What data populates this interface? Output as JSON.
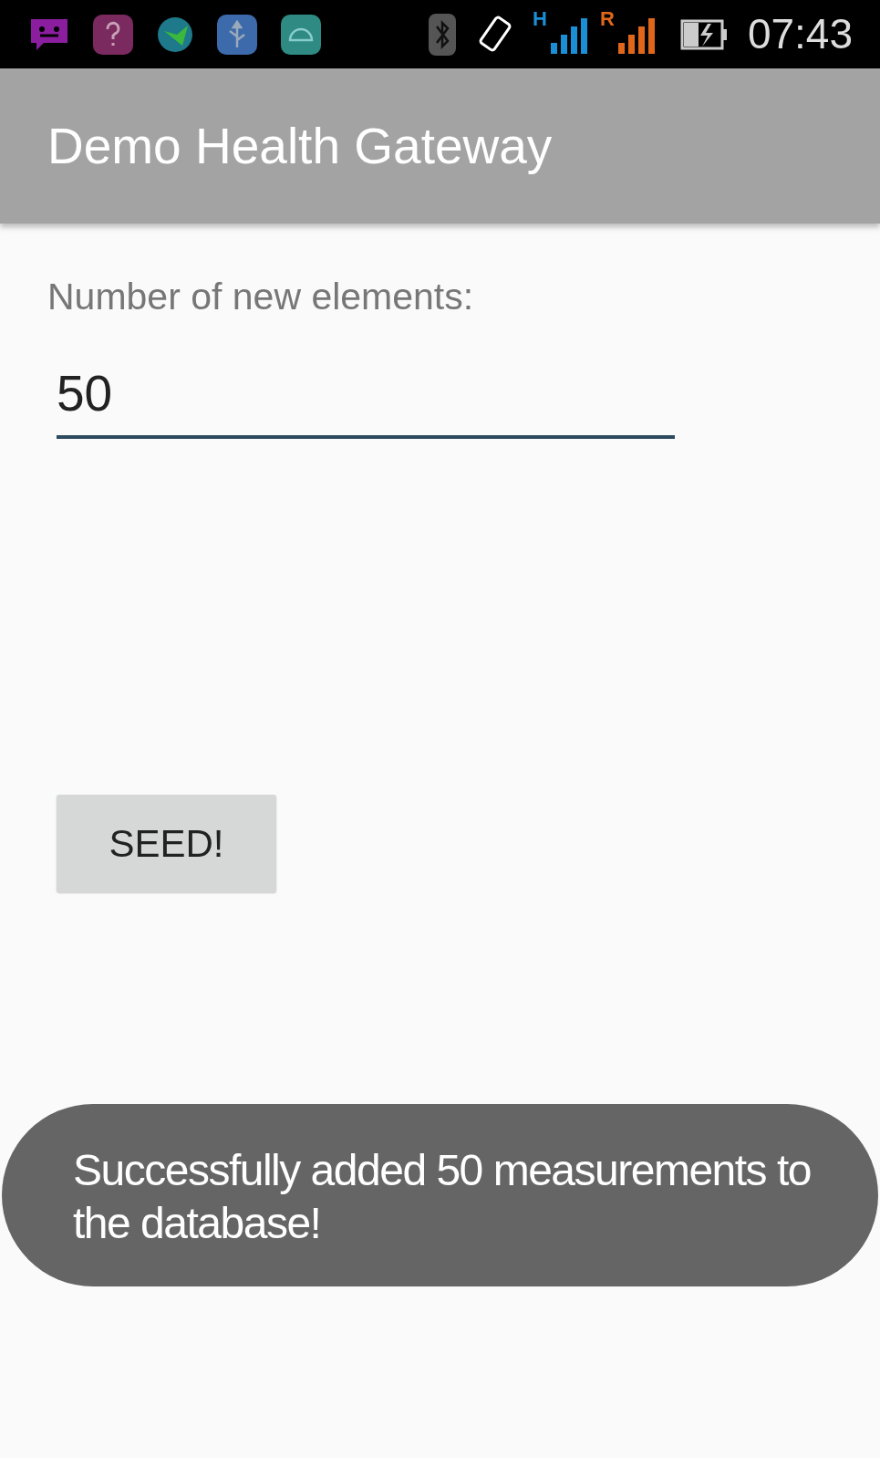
{
  "status_bar": {
    "network_labels": [
      {
        "text": "H",
        "color": "#1a8fd6"
      },
      {
        "text": "R",
        "color": "#e0671a"
      }
    ],
    "time": "07:43"
  },
  "app_bar": {
    "title": "Demo Health Gateway"
  },
  "form": {
    "label": "Number of new elements:",
    "value": "50",
    "focused": true
  },
  "button": {
    "label": "SEED!"
  },
  "toast": {
    "message": "Successfully added 50 measurements to the database!"
  }
}
